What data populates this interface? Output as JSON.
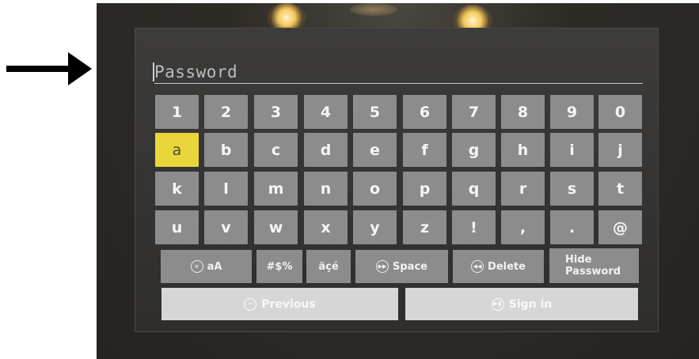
{
  "password_field": {
    "placeholder": "Password"
  },
  "keyboard": {
    "rows": [
      [
        "1",
        "2",
        "3",
        "4",
        "5",
        "6",
        "7",
        "8",
        "9",
        "0"
      ],
      [
        "a",
        "b",
        "c",
        "d",
        "e",
        "f",
        "g",
        "h",
        "i",
        "j"
      ],
      [
        "k",
        "l",
        "m",
        "n",
        "o",
        "p",
        "q",
        "r",
        "s",
        "t"
      ],
      [
        "u",
        "v",
        "w",
        "x",
        "y",
        "z",
        "!",
        ",",
        ".",
        "@"
      ]
    ],
    "selected_key": "a",
    "selected_color": "#e8d63a",
    "function_keys": {
      "case_label": "aA",
      "case_icon": "menu-circle-icon",
      "symbols_label": "#$%",
      "accents_label": "äçé",
      "space_label": "Space",
      "space_icon": "fast-forward-circle-icon",
      "delete_label": "Delete",
      "delete_icon": "rewind-circle-icon",
      "hide_password_line1": "Hide",
      "hide_password_line2": "Password"
    },
    "actions": {
      "previous_label": "Previous",
      "previous_icon": "back-circle-icon",
      "signin_label": "Sign in",
      "signin_icon": "play-pause-circle-icon"
    }
  },
  "annotation": {
    "arrow_icon": "arrow-right-icon"
  }
}
